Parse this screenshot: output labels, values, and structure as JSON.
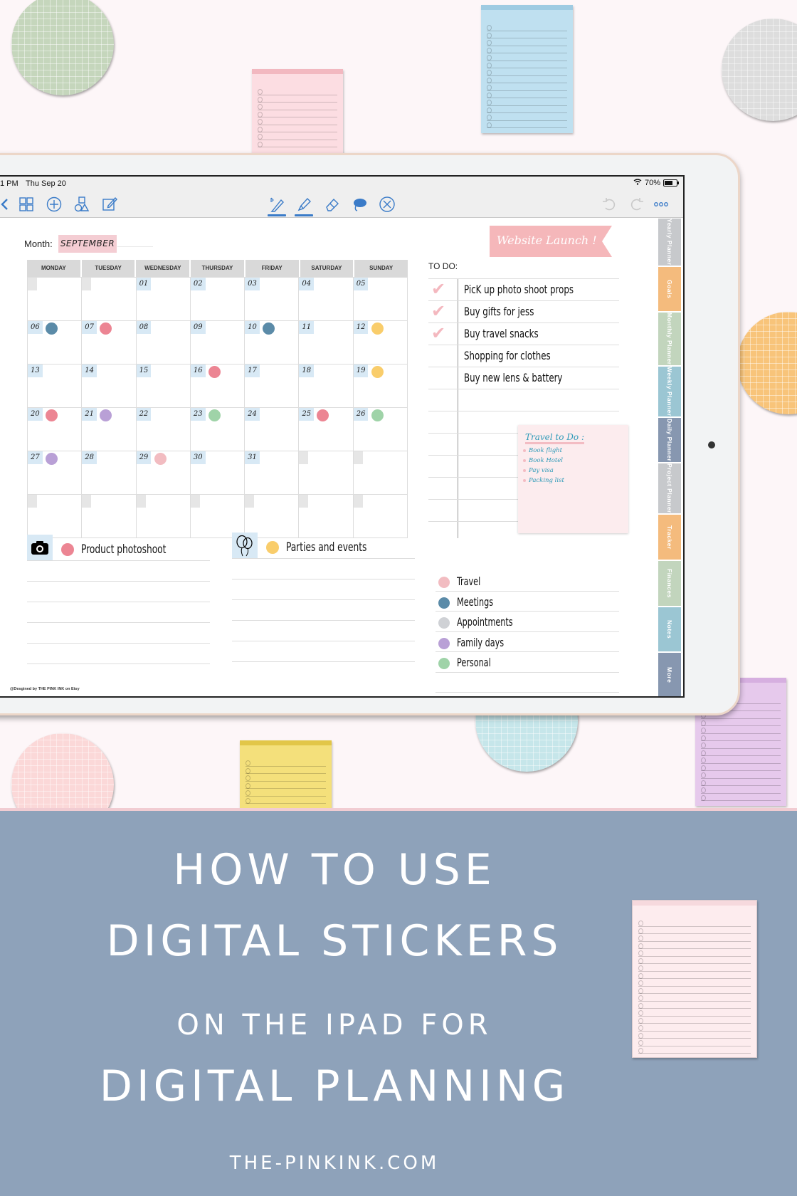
{
  "status_bar": {
    "time": "1 PM",
    "date": "Thu Sep 20",
    "wifi_icon": "wifi-icon",
    "battery": "70%",
    "battery_level": 0.7
  },
  "toolbar": {
    "left_icons": [
      "back-chevron-icon",
      "thumbnail-grid-icon",
      "add-icon",
      "shapes-icon",
      "edit-page-icon"
    ],
    "center_icons": [
      "pen-bluetooth-icon",
      "highlighter-icon",
      "eraser-icon",
      "lasso-icon",
      "close-circle-icon"
    ],
    "right_icons": [
      "undo-icon",
      "redo-icon",
      "more-icon"
    ]
  },
  "page": {
    "month_label": "Month:",
    "month_value": "SEPTEMBER",
    "website_launch_sticker": "Website Launch !",
    "weekdays": [
      "MONDAY",
      "TUESDAY",
      "WEDNESDAY",
      "THURSDAY",
      "FRIDAY",
      "SATURDAY",
      "SUNDAY"
    ],
    "calendar_cells": [
      {
        "n": "",
        "dot": null
      },
      {
        "n": "",
        "dot": null
      },
      {
        "n": "01",
        "dot": null
      },
      {
        "n": "02",
        "dot": null
      },
      {
        "n": "03",
        "dot": null
      },
      {
        "n": "04",
        "dot": null
      },
      {
        "n": "05",
        "dot": null
      },
      {
        "n": "06",
        "dot": "meetings"
      },
      {
        "n": "07",
        "dot": "work"
      },
      {
        "n": "08",
        "dot": null
      },
      {
        "n": "09",
        "dot": null
      },
      {
        "n": "10",
        "dot": "meetings"
      },
      {
        "n": "11",
        "dot": null
      },
      {
        "n": "12",
        "dot": "events"
      },
      {
        "n": "13",
        "dot": null
      },
      {
        "n": "14",
        "dot": null
      },
      {
        "n": "15",
        "dot": null
      },
      {
        "n": "16",
        "dot": "work"
      },
      {
        "n": "17",
        "dot": null
      },
      {
        "n": "18",
        "dot": null
      },
      {
        "n": "19",
        "dot": "events"
      },
      {
        "n": "20",
        "dot": "work"
      },
      {
        "n": "21",
        "dot": "family"
      },
      {
        "n": "22",
        "dot": null
      },
      {
        "n": "23",
        "dot": "personal"
      },
      {
        "n": "24",
        "dot": null
      },
      {
        "n": "25",
        "dot": "work"
      },
      {
        "n": "26",
        "dot": "personal"
      },
      {
        "n": "27",
        "dot": "family"
      },
      {
        "n": "28",
        "dot": null
      },
      {
        "n": "29",
        "dot": "travel"
      },
      {
        "n": "30",
        "dot": null
      },
      {
        "n": "31",
        "dot": null
      },
      {
        "n": "",
        "dot": null
      },
      {
        "n": "",
        "dot": null
      },
      {
        "n": "",
        "dot": null
      },
      {
        "n": "",
        "dot": null
      },
      {
        "n": "",
        "dot": null
      },
      {
        "n": "",
        "dot": null
      },
      {
        "n": "",
        "dot": null
      },
      {
        "n": "",
        "dot": null
      },
      {
        "n": "",
        "dot": null
      }
    ],
    "dot_colors": {
      "meetings": "#5b8ba8",
      "work": "#ec8593",
      "events": "#f9cd6b",
      "family": "#b9a0d6",
      "personal": "#9fd3a8",
      "travel": "#f2bcc1",
      "appointments": "#cfd1d5"
    },
    "todo": {
      "title": "TO DO:",
      "items": [
        {
          "text": "PicK up photo shoot props",
          "done": true
        },
        {
          "text": "Buy gifts for jess",
          "done": true
        },
        {
          "text": "Buy travel snacks",
          "done": true
        },
        {
          "text": "Shopping for clothes",
          "done": false
        },
        {
          "text": "Buy new lens & battery",
          "done": false
        },
        {
          "text": "",
          "done": false
        },
        {
          "text": "",
          "done": false
        },
        {
          "text": "",
          "done": false
        },
        {
          "text": "",
          "done": false
        },
        {
          "text": "",
          "done": false
        },
        {
          "text": "",
          "done": false
        }
      ]
    },
    "sticky_note": {
      "title": "Travel to Do :",
      "items": [
        "Book flight",
        "Book Hotel",
        "Pay visa",
        "Packing list"
      ]
    },
    "sections": [
      {
        "label": "Product photoshoot",
        "icon": "camera-icon",
        "dot": "#ec8593"
      },
      {
        "label": "Parties and events",
        "icon": "balloons-icon",
        "dot": "#f9cd6b"
      }
    ],
    "legend": [
      {
        "label": "Travel",
        "color": "#f2bcc1"
      },
      {
        "label": "Meetings",
        "color": "#5b8ba8"
      },
      {
        "label": "Appointments",
        "color": "#cfd1d5"
      },
      {
        "label": "Family days",
        "color": "#b9a0d6"
      },
      {
        "label": "Personal",
        "color": "#9fd3a8"
      }
    ],
    "credit": "@Desgined by THE PINK INK on Etsy"
  },
  "side_tabs": [
    {
      "label": "Yearly Planner",
      "color": "#c7c9cc"
    },
    {
      "label": "Goals",
      "color": "#f4bb7d"
    },
    {
      "label": "Monthly Planner",
      "color": "#c2d5bd"
    },
    {
      "label": "Weekly Planner",
      "color": "#9bc6d3"
    },
    {
      "label": "Daily Planner",
      "color": "#8797b0"
    },
    {
      "label": "Project Planner",
      "color": "#c7c9cc"
    },
    {
      "label": "Tracker",
      "color": "#f4bb7d"
    },
    {
      "label": "Finances",
      "color": "#c2d5bd"
    },
    {
      "label": "Notes",
      "color": "#9bc6d3"
    },
    {
      "label": "More",
      "color": "#8797b0"
    }
  ],
  "banner": {
    "line1": "HOW TO USE",
    "line2": "DIGITAL STICKERS",
    "line3": "ON THE IPAD FOR",
    "line4": "DIGITAL PLANNING",
    "website": "THE-PINKINK.COM",
    "background": "#8ea2ba"
  }
}
